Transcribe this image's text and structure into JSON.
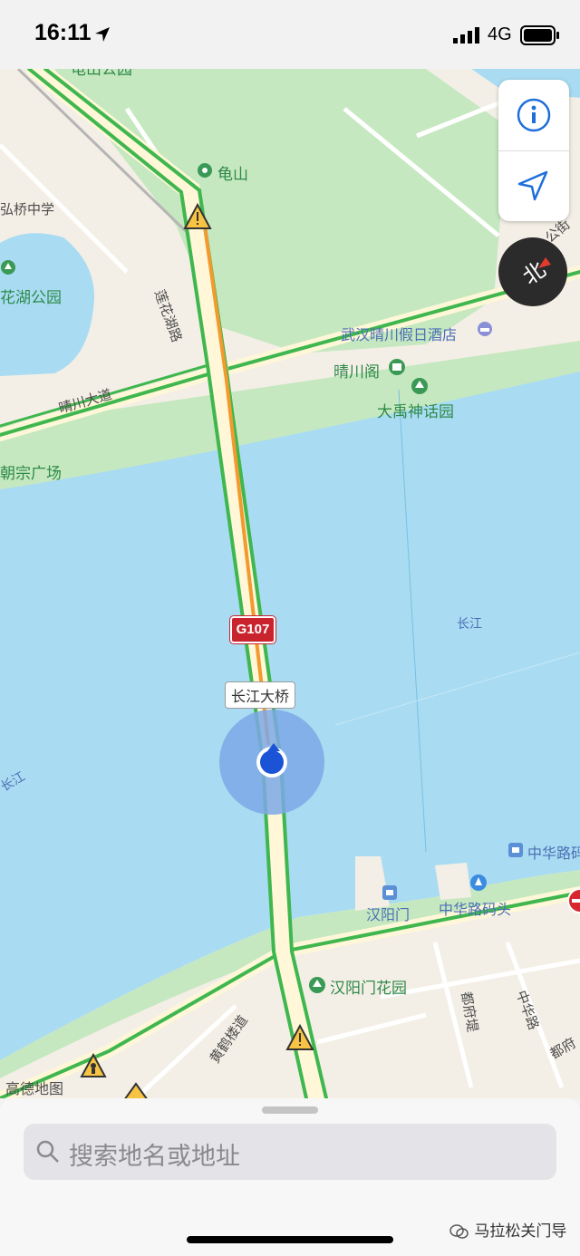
{
  "status_bar": {
    "time": "16:11",
    "network": "4G"
  },
  "map": {
    "labels": {
      "guishan_park": "龟山公园",
      "guishan": "龟山",
      "hongqiao_school": "弘桥中学",
      "lianhuahu_park": "花湖公园",
      "lianhua_rd": "莲花湖路",
      "wuhan_hotel": "武汉晴川假日酒店",
      "qingchuan_pavilion": "晴川阁",
      "qingchuan_ave": "晴川大道",
      "dayu_garden": "大禹神话园",
      "chaozong_square": "朝宗广场",
      "yangtze_river": "长江",
      "yangtze_left": "长江",
      "zhonghua_rd_top": "中华路码",
      "hanyangmen": "汉阳门",
      "zhonghua_pier": "中华路码头",
      "hanyangmen_garden": "汉阳门花园",
      "duhu_di": "都府堤",
      "zhonghua_rd": "中华路",
      "dufu": "都府",
      "huanghelou_rd": "黄鹤楼道",
      "amap": "高德地图",
      "gongjie": "公街"
    },
    "road_shield": "G107",
    "bridge_label": "长江大桥",
    "compass_label": "北",
    "colors": {
      "water": "#a9dcf2",
      "green": "#c6e8c0",
      "road_green": "#3fb74e",
      "road_orange": "#f29a2e",
      "location": "#1a53d6"
    }
  },
  "controls": {
    "info_icon": "info-icon",
    "locate_icon": "location-arrow-icon"
  },
  "search": {
    "placeholder": "搜索地名或地址"
  },
  "watermark": "马拉松关门导"
}
